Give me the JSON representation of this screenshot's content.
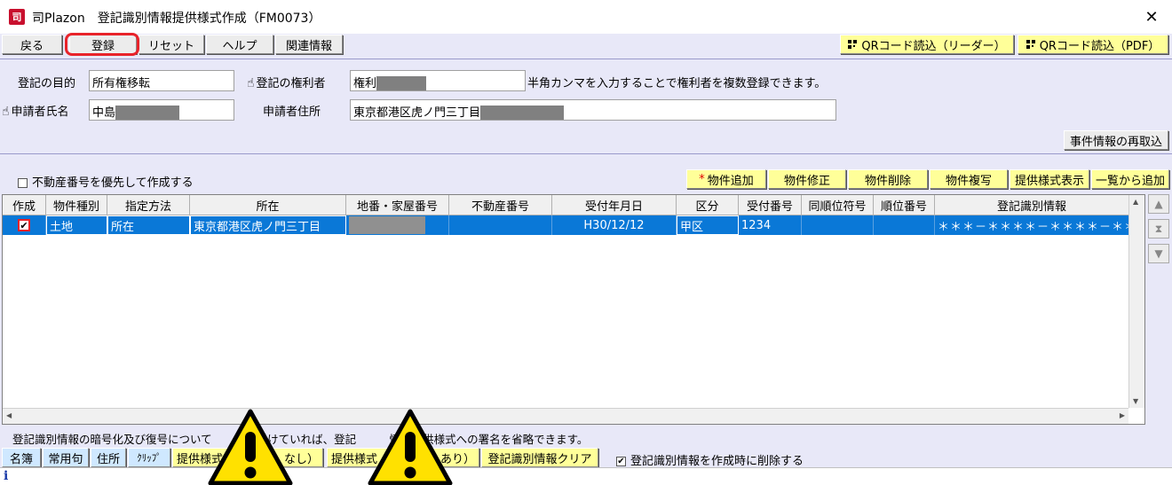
{
  "window": {
    "title": "司Plazon　登記識別情報提供様式作成（FM0073）",
    "icon_letter": "司",
    "close_glyph": "✕"
  },
  "toolbar": {
    "back": "戻る",
    "register": "登録",
    "reset": "リセット",
    "help": "ヘルプ",
    "related": "関連情報",
    "qr_reader": "QRコード読込（リーダー）",
    "qr_pdf": "QRコード読込（PDF）"
  },
  "form": {
    "purpose_label": "登記の目的",
    "purpose_value": "所有権移転",
    "holder_label": "登記の権利者",
    "holder_value": "権利",
    "holder_hint": "半角カンマを入力することで権利者を複数登録できます。",
    "applicant_label": "申請者氏名",
    "applicant_value": "中島",
    "address_label": "申請者住所",
    "address_value": "東京都港区虎ノ門三丁目",
    "reload_button": "事件情報の再取込"
  },
  "options": {
    "prioritize_label": "不動産番号を優先して作成する",
    "prioritize_checked": false
  },
  "actions": {
    "add_property_mark": "*",
    "add_property": "物件追加",
    "edit_property": "物件修正",
    "delete_property": "物件削除",
    "copy_property": "物件複写",
    "show_format": "提供様式表示",
    "add_from_list": "一覧から追加"
  },
  "table": {
    "headers": [
      "作成",
      "物件種別",
      "指定方法",
      "所在",
      "地番・家屋番号",
      "不動産番号",
      "受付年月日",
      "区分",
      "受付番号",
      "同順位符号",
      "順位番号",
      "登記識別情報"
    ],
    "rows": [
      {
        "create_checked": "✔",
        "type": "土地",
        "method": "所在",
        "location": "東京都港区虎ノ門三丁目",
        "lot": "",
        "property_no": "",
        "date": "H30/12/12",
        "division": "甲区",
        "receipt_no": "1234",
        "same_rank": "",
        "rank_no": "",
        "identity_info": "＊＊＊－＊＊＊＊－＊＊＊＊－＊＊＊"
      }
    ]
  },
  "side_nav": {
    "up": "▲",
    "middle": "⧗",
    "down": "▼"
  },
  "footer": {
    "note": "登記識別情報の暗号化及び復号について　　　を受けていれば、登記　　　情報提供様式への署名を省略できます。",
    "name_list": "名簿",
    "phrases": "常用句",
    "address": "住所",
    "clip": "ｸﾘｯﾌﾟ",
    "format_no_sign": "提供様式",
    "format_no_sign_tail": "なし）",
    "format_sign": "提供様式",
    "format_sign_tail": "あり）",
    "clear_identity": "登記識別情報クリア",
    "delete_on_create_label": "登記識別情報を作成時に削除する",
    "delete_on_create_checked": "✔"
  },
  "status": {
    "info_glyph": "i"
  }
}
